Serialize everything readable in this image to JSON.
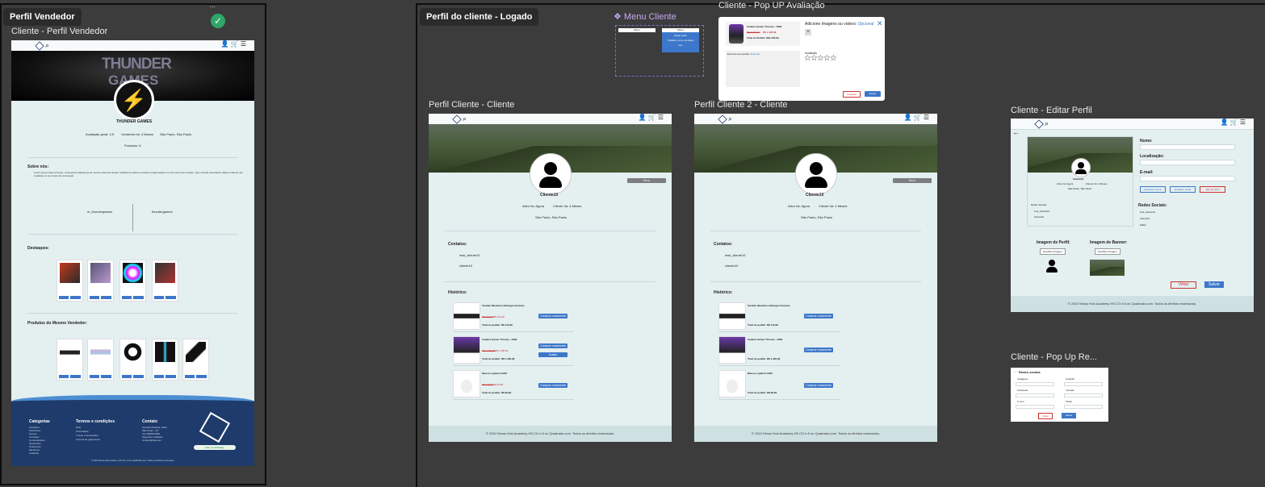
{
  "colors": {
    "canvas": "#3c3c3c",
    "page": "#e4eff0",
    "primary": "#3d77c9",
    "footer": "#1e3b6b",
    "check": "#2fa56a"
  },
  "vendor": {
    "pill": "Perfil Vendedor",
    "dots": "...",
    "frame_title": "Cliente - Perfil Vendedor",
    "banner_text_1": "THUNDER",
    "banner_text_2": "GAMES",
    "store_name": "THUNDER GAMES",
    "stats": [
      "Avaliação geral: 4.5",
      "Vendedor há: 4 Meses",
      "São Paulo, São Paulo"
    ],
    "products_count": "Produtos: 6",
    "about_title": "Sobre nós:",
    "about_text": "Lorem ipsum dolor sit amet, consectetur adipiscing elit, sed do eiusmod tempor incididunt ut labore et dolore magna aliqua. Ut enim ad minim veniam, quis nostrud exercitation ullamco laboris nisi ut aliquip ex ea commodo consequat.",
    "social": [
      "m_thundergames",
      "thundergames"
    ],
    "highlights_title": "Destaques:",
    "same_seller_title": "Produtos do Mesmo Vendedor:",
    "footer": {
      "col1_title": "Categorias",
      "col1": [
        "Hardware",
        "Periféricos",
        "Games",
        "Consoles",
        "Computadores",
        "Acessórios",
        "Notebooks",
        "Monitores",
        "Cadeiras"
      ],
      "col2_title": "Termos e condições",
      "col2": [
        "FAQ",
        "Privacidade",
        "Trocas e devoluções",
        "Formas de pagamento"
      ],
      "col3_title": "Contato",
      "col3": [
        "Avenida Paulista, 1000",
        "São Paulo - SP",
        "(11) 99999-9999",
        "Segunda a Sábado",
        "contato@loja.com"
      ],
      "whatsapp": "Fale no whatsapp",
      "copyright": "© 2024 Senac Hub Academy HS CO e 8 on Quadrado.com. Todos os direitos reservados."
    }
  },
  "logged": {
    "pill": "Perfil do cliente - Logado",
    "menu_title": "❖ Menu Cliente",
    "menu_tabs": [
      "Menu",
      "Menu"
    ],
    "menu_items": [
      "Editar perfil",
      "Trabalhe como vendedor",
      "Sair"
    ],
    "popup_title": "Cliente - Pop UP Avaliação",
    "popup": {
      "product": "Cadeira Gamer Thrones - RGB",
      "old_price": "R$ 3.000,00",
      "new_price": "R$ 1.495,99",
      "total_label": "Total do Pedido: R$1.495,99",
      "add_images": "Adicione Imagens ou vídeos:",
      "optional": "Opcional",
      "comment_label": "Escreva sua opinião:",
      "comment_opt": "Opcional",
      "rating_label": "Avaliação",
      "stars": "☆☆☆☆☆",
      "cancel": "Cancelar",
      "send": "Enviar",
      "plus": "+"
    }
  },
  "client1": {
    "frame_title": "Perfil Cliente - Cliente",
    "name": "Cliente10",
    "btn": "Menu",
    "stats": [
      "Ativo há: Agora",
      "Cliente há: 4 Meses"
    ],
    "location": "São Paulo, São Paulo",
    "contacts_title": "Contatos:",
    "contacts": [
      "insti_cliente10",
      "cliente10"
    ],
    "history_title": "Histórico:",
    "orders": [
      {
        "name": "Teclado Mecânico Redragon Kumara",
        "old": "R$ 290,00",
        "price": "R$ 142,99",
        "total": "Total do pedido: R$ 142,99",
        "btn": "Comprar novamente"
      },
      {
        "name": "Cadeira Gamer Thrones - RGB",
        "old": "R$ 3.000,00",
        "price": "R$ 1.495,99",
        "total": "Total do pedido: R$ 1.495,99",
        "btn": "Comprar novamente",
        "btn2": "Avaliar"
      },
      {
        "name": "Mouse Logitech G203",
        "old": "R$ 249,90",
        "price": "R$ 99,99",
        "total": "Total do pedido: R$ 99,99",
        "btn": "Comprar novamente"
      }
    ],
    "footer": "© 2024 Senac Hub Academy HS CO e 8 on Quadrado.com. Todos os direitos reservados."
  },
  "client2": {
    "frame_title": "Perfil Cliente 2 - Cliente"
  },
  "edit": {
    "frame_title": "Cliente - Editar Perfil",
    "name_label": "Nome:",
    "loc_label": "Localização:",
    "email_label": "E-mail:",
    "buttons": [
      "Redefinir senha",
      "Redefinir email",
      "Sair do perfil"
    ],
    "social_title": "Redes Sociais:",
    "social_items": [
      "insti_cliente10",
      "cliente10"
    ],
    "edit_link": "Editar",
    "profile_img": "Imagem de Perfil:",
    "banner_img": "Imagem de Banner:",
    "change": "Escolher Imagem",
    "back": "Voltar",
    "save": "Salvar",
    "footer": "© 2024 Senac Hub Academy HS CO e 8 on Quadrado.com. Todos os direitos reservados."
  },
  "popup_social": {
    "frame_title": "Cliente -  Pop Up Re...",
    "title": "Redes sociais",
    "items": [
      "Instagram",
      "Facebook",
      "X.com",
      "Linkedin",
      "Youtube",
      "Tiktok"
    ],
    "back": "Voltar",
    "save": "Salvar"
  }
}
